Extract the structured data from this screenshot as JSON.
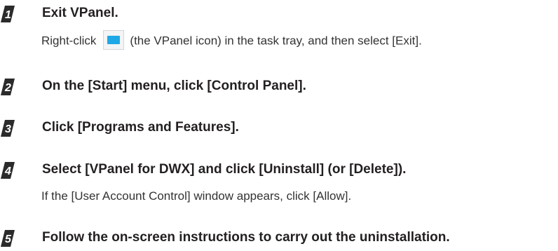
{
  "steps": [
    {
      "number": "1",
      "title": "Exit VPanel.",
      "note_before_icon": "Right-click",
      "icon": "vpanel-icon",
      "note_after_icon": "(the VPanel icon) in the task tray, and then select [Exit]."
    },
    {
      "number": "2",
      "title": "On the [Start] menu, click [Control Panel]."
    },
    {
      "number": "3",
      "title": "Click [Programs and Features]."
    },
    {
      "number": "4",
      "title": "Select [VPanel for DWX] and click [Uninstall] (or [Delete]).",
      "note": "If the [User Account Control] window appears, click [Allow]."
    },
    {
      "number": "5",
      "title": "Follow the on-screen instructions to carry out the uninstallation."
    }
  ],
  "colors": {
    "text": "#231f20",
    "badge": "#2b2b2b",
    "icon_accent": "#1ea8e6"
  }
}
